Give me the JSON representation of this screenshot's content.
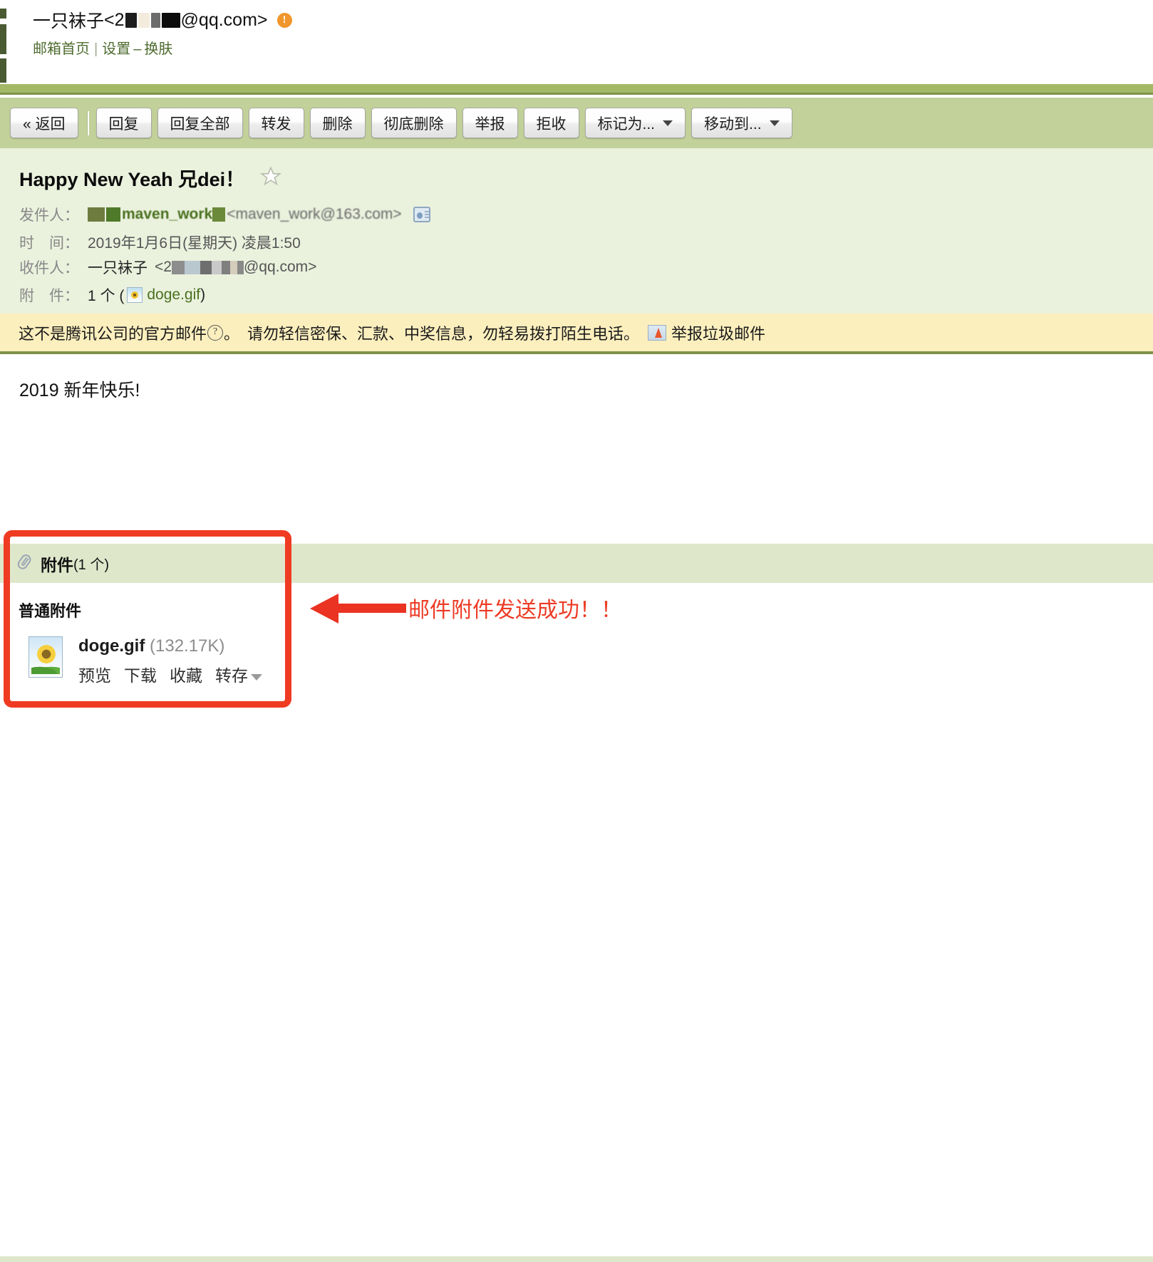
{
  "account": {
    "display_name": "一只袜子",
    "email_prefix": "<2",
    "email_suffix": "@qq.com>",
    "alert_badge": "!",
    "nav": {
      "home": "邮箱首页",
      "separator": "|",
      "settings": "设置",
      "dash": "–",
      "skin": "换肤"
    }
  },
  "toolbar": {
    "back": "« 返回",
    "reply": "回复",
    "reply_all": "回复全部",
    "forward": "转发",
    "delete": "删除",
    "delete_permanently": "彻底删除",
    "report": "举报",
    "reject": "拒收",
    "mark_as": "标记为...",
    "move_to": "移动到..."
  },
  "mail": {
    "subject": "Happy New Yeah 兄dei！",
    "star_icon": "star-outline-icon",
    "labels": {
      "from": "发件人：",
      "time": "时　间：",
      "to": "收件人：",
      "attachment": "附　件："
    },
    "from": {
      "name_redacted": "maven_work",
      "address": "<maven_work@163.com>",
      "contact_card_icon": "contact-card-icon"
    },
    "time": "2019年1月6日(星期天) 凌晨1:50",
    "to": {
      "name": "一只袜子",
      "address_prefix": "<2",
      "address_suffix": "@qq.com>"
    },
    "attachment_summary": {
      "count": "1 个 (",
      "file": "doge.gif",
      "close": ")"
    }
  },
  "warning": {
    "text_before": "这不是腾讯公司的官方邮件",
    "help_icon": "?",
    "text_after": "。　请勿轻信密保、汇款、中奖信息，勿轻易拨打陌生电话。",
    "report_link": "举报垃圾邮件",
    "report_icon": "report-spam-icon",
    "background": "#fcefbe"
  },
  "body": {
    "content": "2019 新年快乐!"
  },
  "attachments_panel": {
    "clip_icon": "paperclip-icon",
    "header_title": "附件",
    "header_count": "(1 个)",
    "group_label": "普通附件",
    "items": [
      {
        "thumbnail_icon": "image-file-icon",
        "name": "doge.gif",
        "size": "(132.17K)",
        "actions": [
          "预览",
          "下载",
          "收藏",
          "转存"
        ]
      }
    ]
  },
  "annotation": {
    "text": "邮件附件发送成功！！",
    "color": "#ed3b24",
    "arrow_icon": "left-arrow-icon",
    "box_icon": "highlight-box"
  },
  "colors": {
    "band_green": "#a3b966",
    "toolbar_green": "#c2d199",
    "header_green": "#eaf1dd",
    "attach_band": "#dfe7cb",
    "warning_yellow": "#fcefbe",
    "link_green": "#4e6b2e",
    "annotation_red": "#ed3b24"
  }
}
